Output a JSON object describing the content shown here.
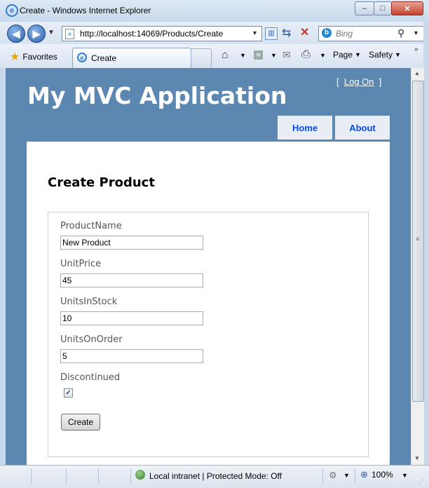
{
  "window": {
    "title": "Create - Windows Internet Explorer"
  },
  "address": {
    "url": "http://localhost:14069/Products/Create"
  },
  "search": {
    "placeholder": "Bing"
  },
  "toolbar": {
    "favorites": "Favorites",
    "tab_title": "Create",
    "page_menu": "Page",
    "safety_menu": "Safety"
  },
  "site": {
    "title": "My MVC Application",
    "logon_prefix": "[",
    "logon_link": "Log On",
    "logon_suffix": "]",
    "menu": [
      "Home",
      "About"
    ]
  },
  "form": {
    "heading": "Create Product",
    "fields": [
      {
        "label": "ProductName",
        "value": "New Product"
      },
      {
        "label": "UnitPrice",
        "value": "45"
      },
      {
        "label": "UnitsInStock",
        "value": "10"
      },
      {
        "label": "UnitsOnOrder",
        "value": "5"
      }
    ],
    "discontinued_label": "Discontinued",
    "discontinued_checked": true,
    "submit_label": "Create"
  },
  "status": {
    "zone": "Local intranet | Protected Mode: Off",
    "zoom": "100%"
  },
  "colors": {
    "page_background": "#5b87b0",
    "menu_link": "#034af3"
  }
}
